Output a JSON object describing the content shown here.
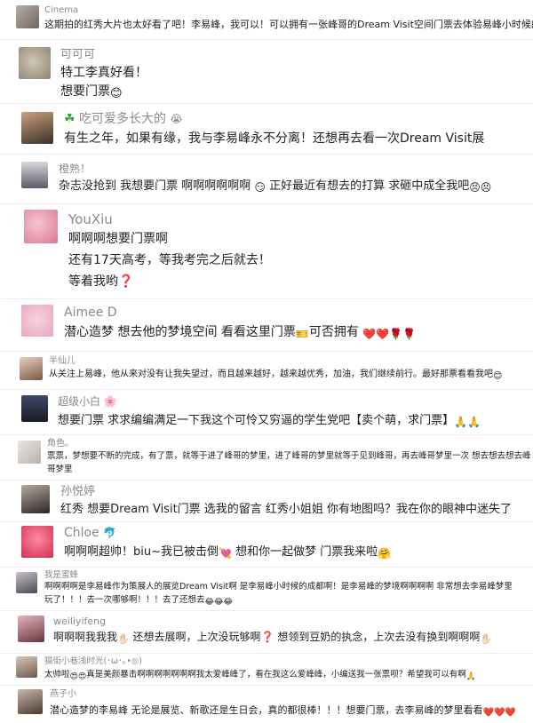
{
  "comments": [
    {
      "name": "Cinema",
      "lines": [
        "这期拍的红秀大片也太好看了吧！李易峰，我可以！可以拥有一张峰哥的Dream Visit空间门票去体验易峰小时候的生活吗"
      ]
    },
    {
      "name": "可可可",
      "lines": [
        "特工李真好看！",
        "想要门票"
      ]
    },
    {
      "name": "吃可爱多长大的",
      "lines": [
        "有生之年，如果有缘，我与李易峰永不分离！还想再去看一次Dream Visit展"
      ]
    },
    {
      "name": "橙熟！",
      "lines": [
        "杂志没抢到 我想要门票 啊啊啊啊啊啊",
        "正好最近有想去的打算 求砸中成全我吧"
      ]
    },
    {
      "name": "YouXiu",
      "lines": [
        "啊啊啊想要门票啊",
        "还有17天高考，等我考完之后就去！",
        "等着我哟"
      ]
    },
    {
      "name": "Aimee D",
      "lines": [
        "潜心造梦 想去他的梦境空间 看看这里门票",
        "可否拥有"
      ]
    },
    {
      "name": "半仙儿",
      "lines": [
        "从关注上易峰，他从来对没有让我失望过，而且越来越好，越来越优秀，加油，我们继续前行。最好那票看看我吧"
      ]
    },
    {
      "name": "超级小白",
      "lines": [
        "想要门票 求求编编满足一下我这个可怜又穷逼的学生党吧【卖个萌，求门票】"
      ]
    },
    {
      "name": "角色。",
      "lines": [
        "票票，梦想要不断的完成，有了票，就等于进了峰哥的梦里，进了峰哥的梦里就等于见到峰哥，再去峰哥梦里一次 想去想去想去峰",
        "哥梦里"
      ]
    },
    {
      "name": "孙悦婷",
      "lines": [
        "红秀 想要Dream Visit门票 选我的留言 红秀小姐姐 你有地图吗？我在你的眼神中迷失了"
      ]
    },
    {
      "name": "Chloe",
      "lines": [
        "啊啊啊超帅！biu~我已被击倒",
        "想和你一起做梦 门票我来啦"
      ]
    },
    {
      "name": "我是蜜蜂",
      "lines": [
        "啊啊啊啊是李易峰作为策展人的展览Dream Visit啊 是李易峰小时候的成都啊！是李易峰的梦境啊啊啊啊 非常想去李易峰梦里",
        "玩了！！！去一次哪够啊！！！去了还想去"
      ]
    },
    {
      "name": "weiliyifeng",
      "lines": [
        "啊啊啊我我我",
        "还想去展啊，上次没玩够啊",
        "想领到豆奶的执念，上次去没有换到啊啊啊"
      ]
    },
    {
      "name": "猫街小巷浅时光(･ω･｡•◎)",
      "lines": [
        "太帅啦",
        "真是美颜暴击啊啊啊啊啊啊啊我太爱峰峰了，看在我这么爱峰峰，小编送我一张票呗？希望我可以有啊"
      ]
    },
    {
      "name": "燕子小",
      "lines": [
        "潜心造梦的李易峰 无论是展览、新歌还是生日会，真的都很棒！！！想要门票，去李易峰的梦里看看"
      ]
    }
  ]
}
